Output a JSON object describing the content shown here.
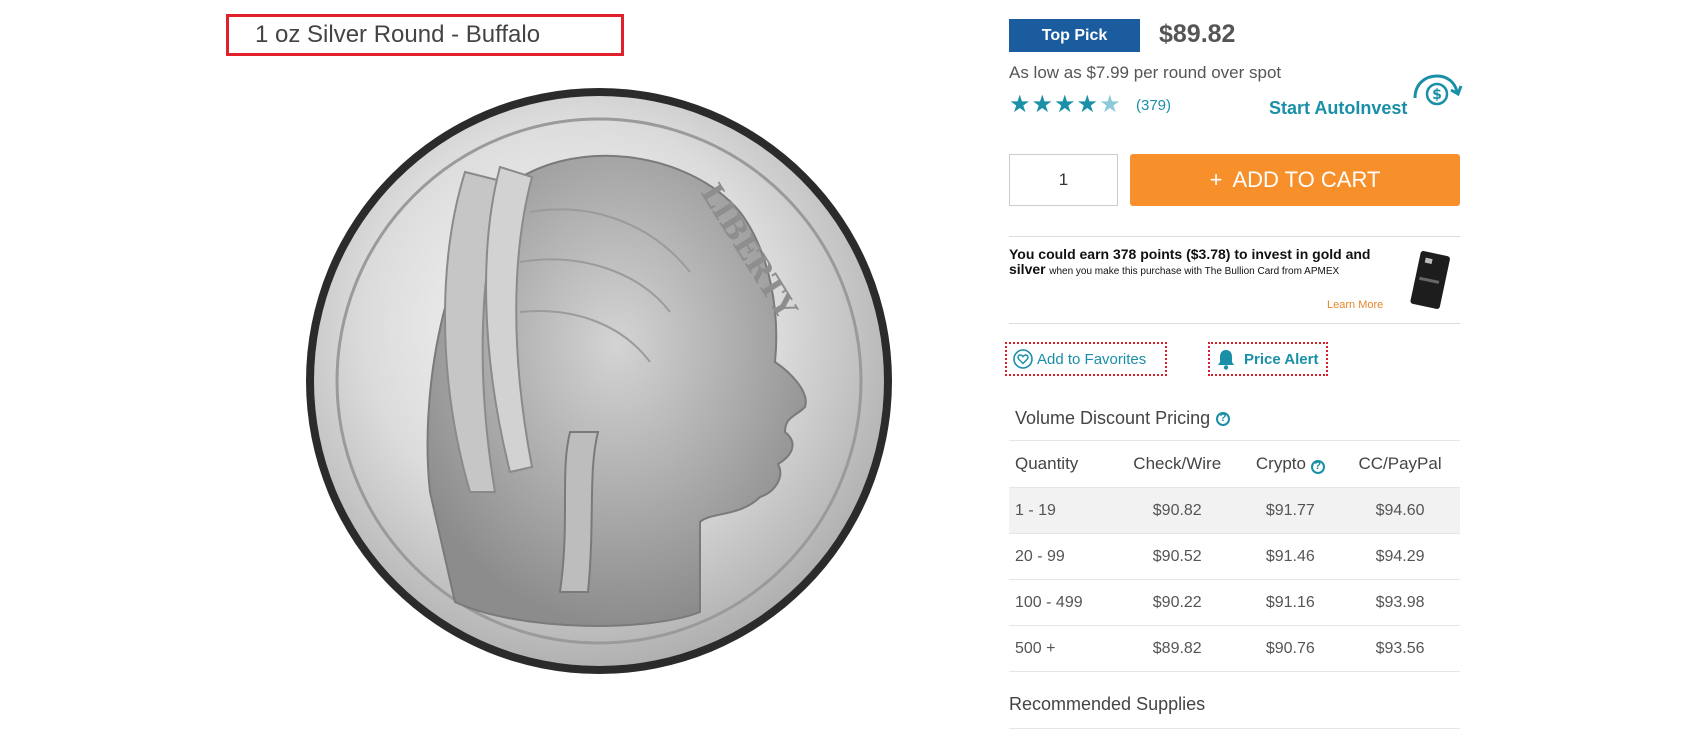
{
  "product": {
    "title": "1 oz Silver Round - Buffalo",
    "coin_inscription": "LIBERTY"
  },
  "buybox": {
    "badge": "Top Pick",
    "price": "$89.82",
    "as_low_as": "As low as $7.99 per round over spot",
    "rating_stars": 4.5,
    "reviews": "(379)",
    "autoinvest": "Start AutoInvest",
    "quantity": "1",
    "add_to_cart": "ADD TO CART",
    "add_to_cart_icon": "plus-icon"
  },
  "points": {
    "bold_text": "You could earn 378 points ($3.78) to invest in gold and silver",
    "small_text": "when you make this purchase with The Bullion Card from APMEX",
    "learn_more": "Learn More"
  },
  "actions": {
    "favorites": "Add to Favorites",
    "price_alert": "Price Alert"
  },
  "volume": {
    "title": "Volume Discount Pricing",
    "headers": [
      "Quantity",
      "Check/Wire",
      "Crypto",
      "CC/PayPal"
    ],
    "rows": [
      [
        "1 - 19",
        "$90.82",
        "$91.77",
        "$94.60"
      ],
      [
        "20 - 99",
        "$90.52",
        "$91.46",
        "$94.29"
      ],
      [
        "100 - 499",
        "$90.22",
        "$91.16",
        "$93.98"
      ],
      [
        "500 +",
        "$89.82",
        "$90.76",
        "$93.56"
      ]
    ]
  },
  "recommended": "Recommended Supplies",
  "colors": {
    "accent": "#1a8fa8",
    "badge": "#1b5c9e",
    "cart": "#f7902b",
    "highlight": "#e0202a"
  }
}
